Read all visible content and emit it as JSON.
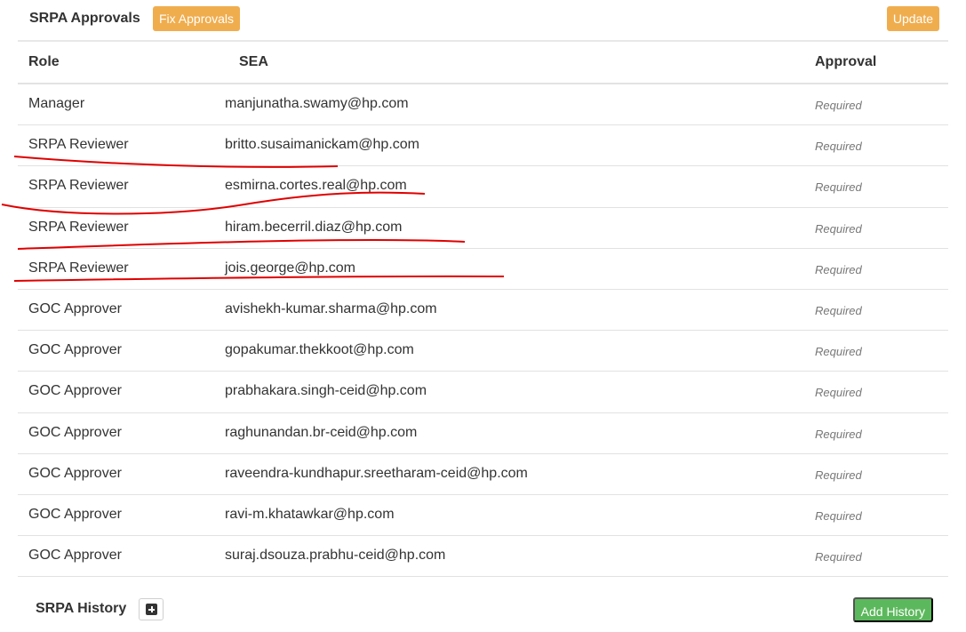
{
  "header": {
    "title": "SRPA Approvals",
    "fix_button": "Fix Approvals",
    "update_button": "Update"
  },
  "table": {
    "columns": [
      "Role",
      "SEA",
      "Approval"
    ],
    "rows": [
      {
        "role": "Manager",
        "sea": "manjunatha.swamy@hp.com",
        "approval": "Required"
      },
      {
        "role": "SRPA Reviewer",
        "sea": "britto.susaimanickam@hp.com",
        "approval": "Required"
      },
      {
        "role": "SRPA Reviewer",
        "sea": "esmirna.cortes.real@hp.com",
        "approval": "Required"
      },
      {
        "role": "SRPA Reviewer",
        "sea": "hiram.becerril.diaz@hp.com",
        "approval": "Required"
      },
      {
        "role": "SRPA Reviewer",
        "sea": "jois.george@hp.com",
        "approval": "Required"
      },
      {
        "role": "GOC Approver",
        "sea": "avishekh-kumar.sharma@hp.com",
        "approval": "Required"
      },
      {
        "role": "GOC Approver",
        "sea": "gopakumar.thekkoot@hp.com",
        "approval": "Required"
      },
      {
        "role": "GOC Approver",
        "sea": "prabhakara.singh-ceid@hp.com",
        "approval": "Required"
      },
      {
        "role": "GOC Approver",
        "sea": "raghunandan.br-ceid@hp.com",
        "approval": "Required"
      },
      {
        "role": "GOC Approver",
        "sea": "raveendra-kundhapur.sreetharam-ceid@hp.com",
        "approval": "Required"
      },
      {
        "role": "GOC Approver",
        "sea": "ravi-m.khatawkar@hp.com",
        "approval": "Required"
      },
      {
        "role": "GOC Approver",
        "sea": "suraj.dsouza.prabhu-ceid@hp.com",
        "approval": "Required"
      }
    ]
  },
  "history": {
    "title": "SRPA History",
    "add_icon": "plus-square-icon",
    "add_button": "Add History"
  },
  "colors": {
    "orange_button": "#f0ad4e",
    "green_button": "#5cb85c",
    "annotation_red": "#e00000"
  }
}
